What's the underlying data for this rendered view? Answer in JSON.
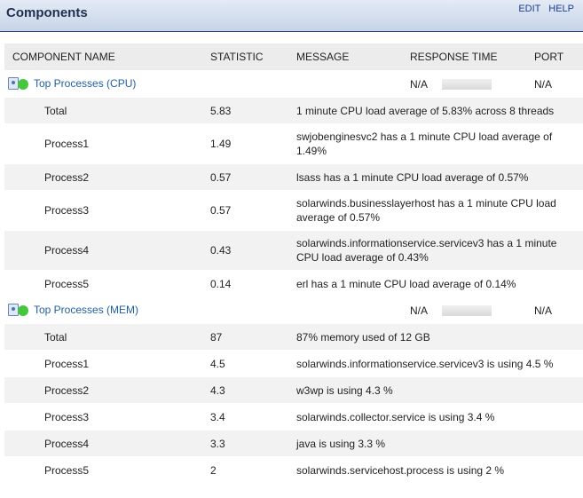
{
  "header": {
    "title": "Components",
    "edit_label": "EDIT",
    "help_label": "HELP"
  },
  "columns": {
    "name": "COMPONENT NAME",
    "statistic": "STATISTIC",
    "message": "MESSAGE",
    "response_time": "RESPONSE TIME",
    "port": "PORT"
  },
  "groups": [
    {
      "name": "Top Processes (CPU)",
      "response_time": "N/A",
      "port": "N/A",
      "rows": [
        {
          "name": "Total",
          "statistic": "5.83",
          "message": "1 minute CPU load average of 5.83% across 8 threads"
        },
        {
          "name": "Process1",
          "statistic": "1.49",
          "message": "swjobenginesvc2 has a 1 minute CPU load average of 1.49%"
        },
        {
          "name": "Process2",
          "statistic": "0.57",
          "message": "lsass has a 1 minute CPU load average of 0.57%"
        },
        {
          "name": "Process3",
          "statistic": "0.57",
          "message": "solarwinds.businesslayerhost has a 1 minute CPU load average of 0.57%"
        },
        {
          "name": "Process4",
          "statistic": "0.43",
          "message": "solarwinds.informationservice.servicev3 has a 1 minute CPU load average of 0.43%"
        },
        {
          "name": "Process5",
          "statistic": "0.14",
          "message": "erl has a 1 minute CPU load average of 0.14%"
        }
      ]
    },
    {
      "name": "Top Processes (MEM)",
      "response_time": "N/A",
      "port": "N/A",
      "rows": [
        {
          "name": "Total",
          "statistic": "87",
          "message": "87% memory used of 12 GB"
        },
        {
          "name": "Process1",
          "statistic": "4.5",
          "message": "solarwinds.informationservice.servicev3 is using 4.5 %"
        },
        {
          "name": "Process2",
          "statistic": "4.3",
          "message": "w3wp is using 4.3 %"
        },
        {
          "name": "Process3",
          "statistic": "3.4",
          "message": "solarwinds.collector.service is using 3.4 %"
        },
        {
          "name": "Process4",
          "statistic": "3.3",
          "message": "java is using 3.3 %"
        },
        {
          "name": "Process5",
          "statistic": "2",
          "message": "solarwinds.servicehost.process is using 2 %"
        }
      ]
    }
  ]
}
